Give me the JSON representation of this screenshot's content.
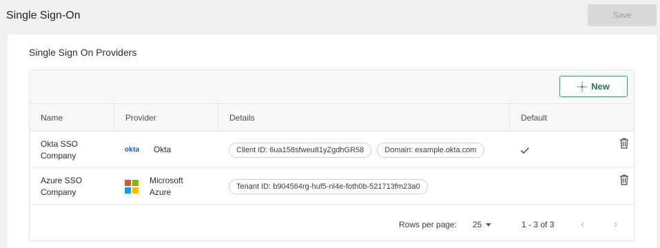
{
  "header": {
    "title": "Single Sign-On",
    "save_label": "Save"
  },
  "card": {
    "title": "Single Sign On Providers",
    "new_label": "New"
  },
  "table": {
    "columns": [
      "Name",
      "Provider",
      "Details",
      "Default"
    ],
    "rows": [
      {
        "name_line1": "Okta SSO",
        "name_line2": "Company",
        "provider_logo": "okta",
        "provider_line1": "Okta",
        "provider_line2": "",
        "details": [
          "Client ID: 6ua158sfweu81yZgdhGR58",
          "Domain: example.okta.com"
        ],
        "default": true
      },
      {
        "name_line1": "Azure SSO",
        "name_line2": "Company",
        "provider_logo": "microsoft-logo",
        "provider_line1": "Microsoft",
        "provider_line2": "Azure",
        "details": [
          "Tenant ID: b904564rg-huf5-nl4e-foth0b-521713fm23a0"
        ],
        "default": false
      }
    ]
  },
  "pagination": {
    "rows_per_page_label": "Rows per page:",
    "rows_per_page_value": "25",
    "range_text": "1 - 3 of 3"
  },
  "colors": {
    "accent_green": "#1f7a4d",
    "okta_blue": "#0b5bd3",
    "ms_red": "#f25022",
    "ms_green": "#7fba00",
    "ms_blue": "#00a4ef",
    "ms_yellow": "#ffb900"
  }
}
